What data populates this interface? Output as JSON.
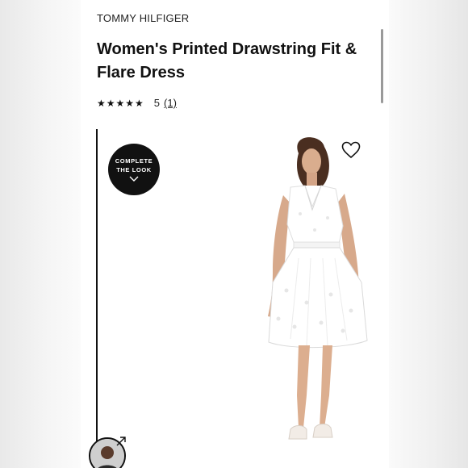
{
  "product": {
    "brand": "TOMMY HILFIGER",
    "title": "Women's Printed Drawstring Fit & Flare Dress",
    "rating": {
      "stars_display": "★★★★★",
      "value": "5",
      "count": "(1)",
      "stars_filled": 5,
      "stars_total": 5
    }
  },
  "complete_look": {
    "line1": "COMPLETE",
    "line2": "THE LOOK",
    "chevron": "chevron-down-icon"
  },
  "icons": {
    "favorite": "heart-icon",
    "share": "share-arrow-icon"
  },
  "colors": {
    "text": "#111111",
    "badge_bg": "#111111",
    "dress": "#ffffff"
  }
}
